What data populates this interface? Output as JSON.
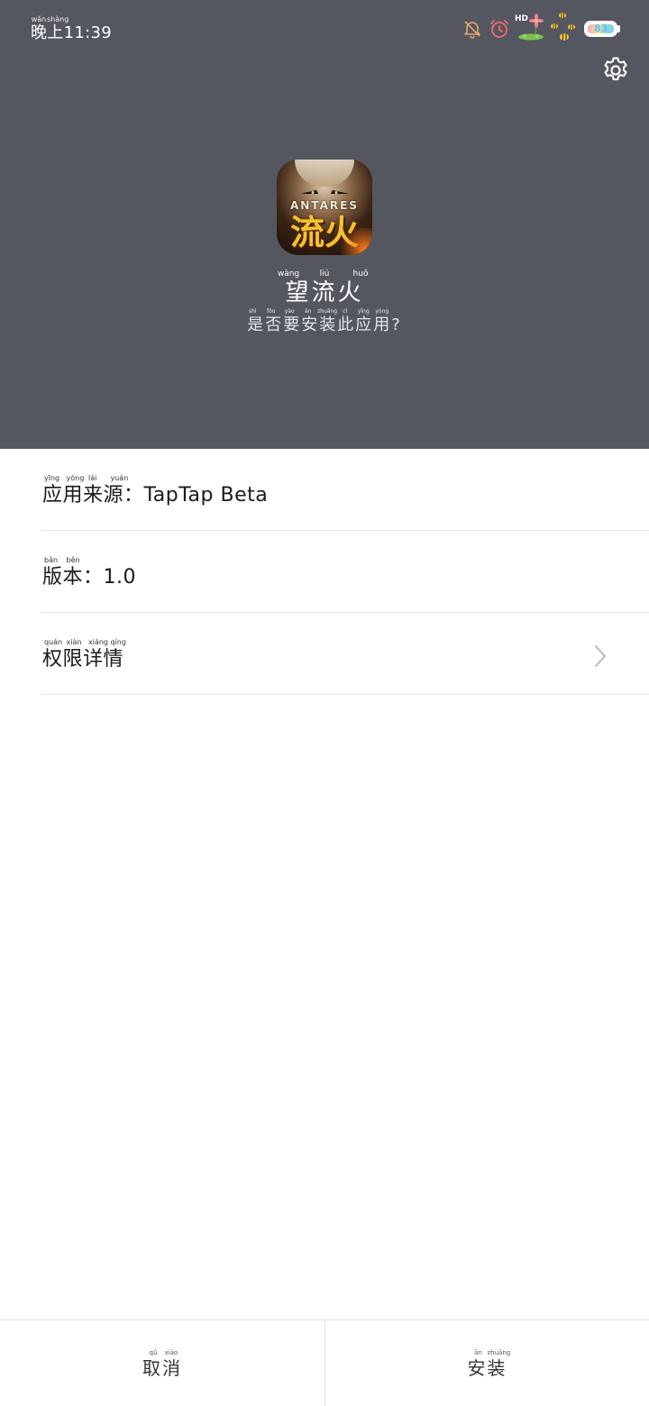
{
  "status_bar": {
    "time_pinyin": [
      "wǎn",
      "shàng"
    ],
    "time": "晚上11:39",
    "hd_label": "HD",
    "battery_level": "83",
    "icons": [
      "bell-off-icon",
      "alarm-clock-icon",
      "hd-signal-icon",
      "flower-sticker-icon",
      "bee-sticker-icon",
      "battery-icon"
    ]
  },
  "header": {
    "settings_icon": "gear-icon",
    "app_icon": {
      "band_text": "ANTARES",
      "logo_text": "流火"
    },
    "app_name_pinyin": [
      "wàng",
      "liú",
      "huǒ"
    ],
    "app_name": "望流火",
    "prompt_pinyin": [
      "shì",
      "fǒu",
      "yào",
      "ān",
      "zhuāng",
      "cǐ",
      "yīng",
      "yòng"
    ],
    "prompt": "是否要安装此应用?"
  },
  "info": {
    "source": {
      "pinyin": [
        "yīng",
        "yòng",
        "lái",
        "yuán"
      ],
      "label": "应用来源：TapTap Beta"
    },
    "version": {
      "pinyin": [
        "bǎn",
        "běn"
      ],
      "label": "版本：1.0"
    },
    "permissions": {
      "pinyin": [
        "quán",
        "xiàn",
        "xiáng",
        "qíng"
      ],
      "label": "权限详情",
      "icon": "chevron-right-icon"
    }
  },
  "buttons": {
    "cancel": {
      "pinyin": [
        "qǔ",
        "xiāo"
      ],
      "label": "取消"
    },
    "install": {
      "pinyin": [
        "ān",
        "zhuāng"
      ],
      "label": "安装"
    }
  },
  "colors": {
    "header_bg": "#54575f",
    "battery_fill": "#7fe0d8",
    "alarm": "#f06a72",
    "bell": "#e8a66a"
  }
}
